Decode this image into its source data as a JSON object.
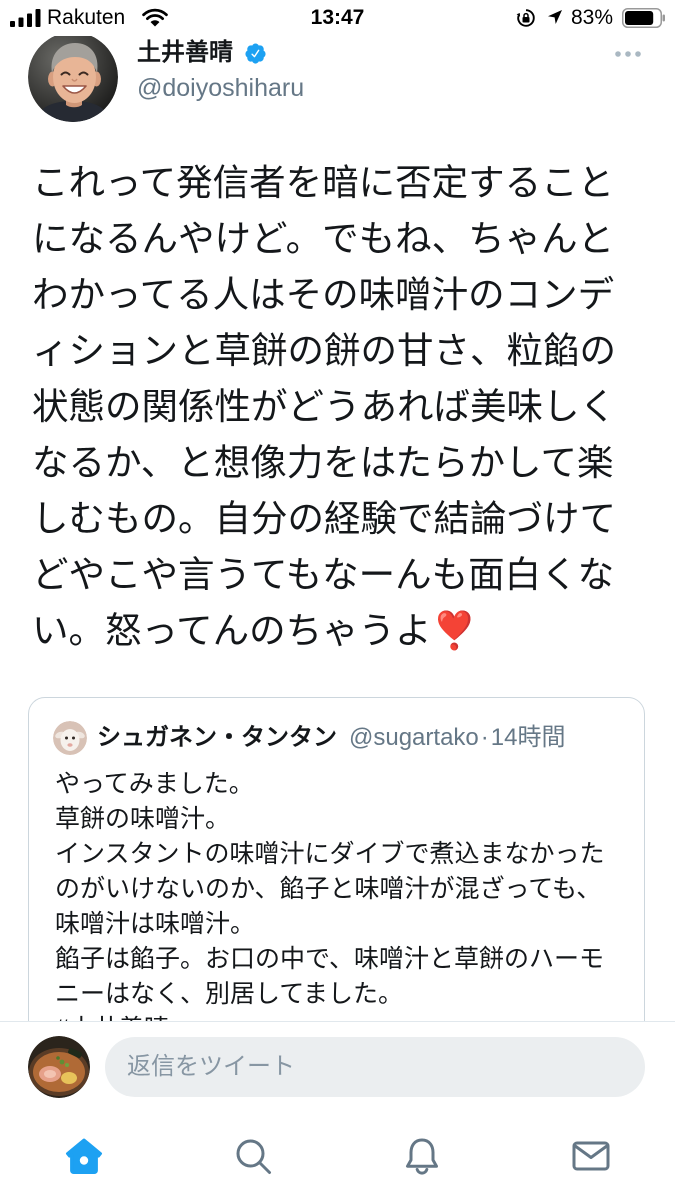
{
  "status_bar": {
    "carrier": "Rakuten",
    "time": "13:47",
    "battery_percent": "83%",
    "icons": [
      "signal-icon",
      "wifi-icon",
      "orientation-lock-icon",
      "location-icon",
      "battery-icon"
    ]
  },
  "tweet": {
    "author": {
      "name": "土井善晴",
      "handle": "@doiyoshiharu",
      "verified": true
    },
    "more_icon": "more-icon",
    "text": "これって発信者を暗に否定することになるんやけど。でもね、ちゃんとわかってる人はその味噌汁のコンディションと草餅の餅の甘さ、粒餡の状態の関係性がどうあれば美味しくなるか、と想像力をはたらかして楽しむもの。自分の経験で結論づけてどやこや言うてもなーんも面白くない。怒ってんのちゃうよ❣️"
  },
  "quoted_tweet": {
    "author": {
      "name": "シュガネン・タンタン",
      "handle": "@sugartako"
    },
    "separator": "·",
    "time": "14時間",
    "text": "やってみました。\n草餅の味噌汁。\nインスタントの味噌汁にダイブで煮込まなかったのがいけないのか、餡子と味噌汁が混ざっても、\n味噌汁は味噌汁。\n餡子は餡子。お口の中で、味噌汁と草餅のハーモニーはなく、別居してました。\n#土井善晴"
  },
  "reply_composer": {
    "placeholder": "返信をツイート"
  },
  "tab_bar": {
    "items": [
      {
        "icon": "home-icon",
        "active": true
      },
      {
        "icon": "search-icon",
        "active": false
      },
      {
        "icon": "bell-icon",
        "active": false
      },
      {
        "icon": "mail-icon",
        "active": false
      }
    ]
  },
  "colors": {
    "accent": "#1da1f2",
    "text": "#14171a",
    "secondary_text": "#657786",
    "border": "#ccd6dd",
    "composer_background": "#ebeef0",
    "emoji": "#e0245e",
    "more_icon": "#aab8c2"
  }
}
